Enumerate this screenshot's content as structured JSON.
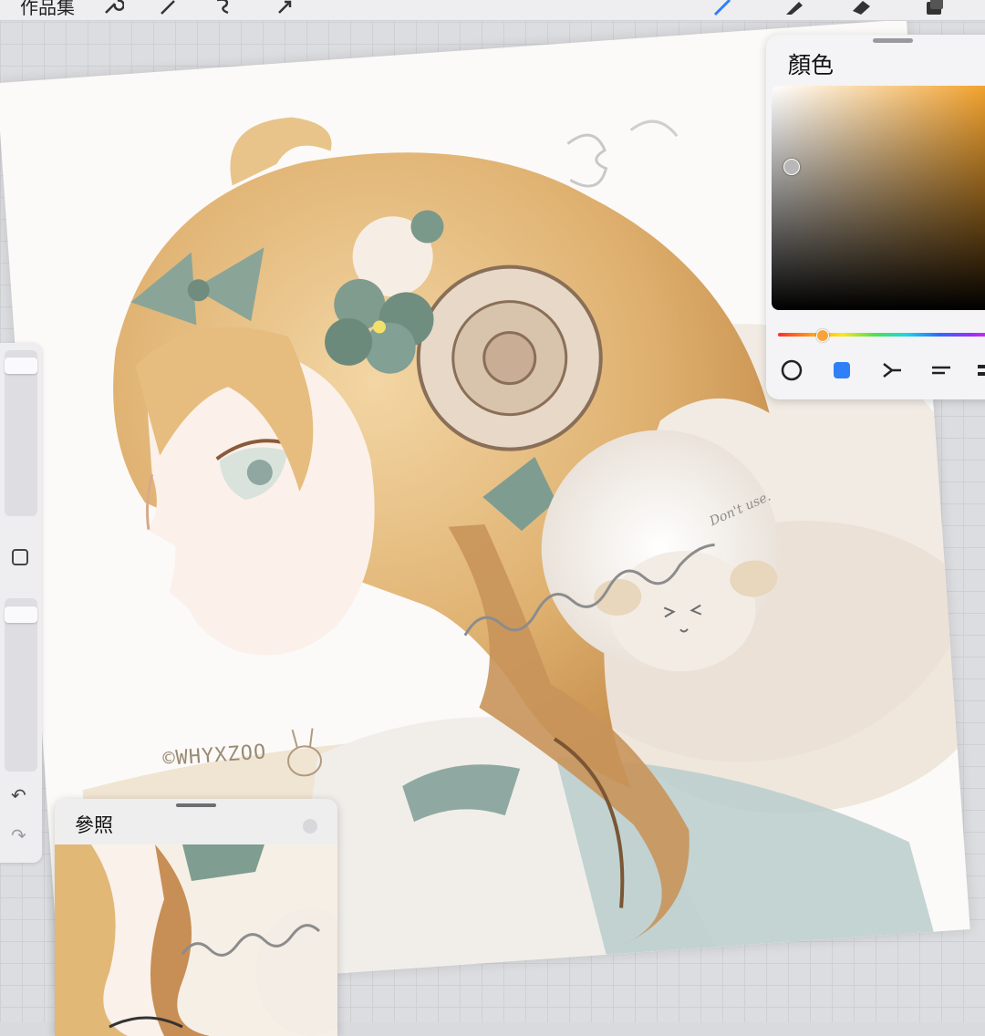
{
  "toolbar": {
    "gallery_label": "作品集",
    "tools": [
      "wrench-icon",
      "magic-wand-icon",
      "selection-icon",
      "transform-arrow-icon",
      "brush-icon",
      "smudge-icon",
      "eraser-icon",
      "layers-icon"
    ],
    "accent": "#2f7ff7"
  },
  "canvas": {
    "watermark_signature": "©WHYXZOO",
    "watermark_note": "Don't use."
  },
  "color_panel": {
    "title": "顏色",
    "current_color": "#f19a1c",
    "tabs": [
      "disc-tab-icon",
      "classic-tab-icon",
      "harmony-tab-icon",
      "value-tab-icon",
      "palettes-tab-icon"
    ],
    "selected_tab": 1
  },
  "reference_panel": {
    "title": "參照"
  },
  "sidebar": {
    "size_level": 0.95,
    "opacity_level": 0.95
  }
}
